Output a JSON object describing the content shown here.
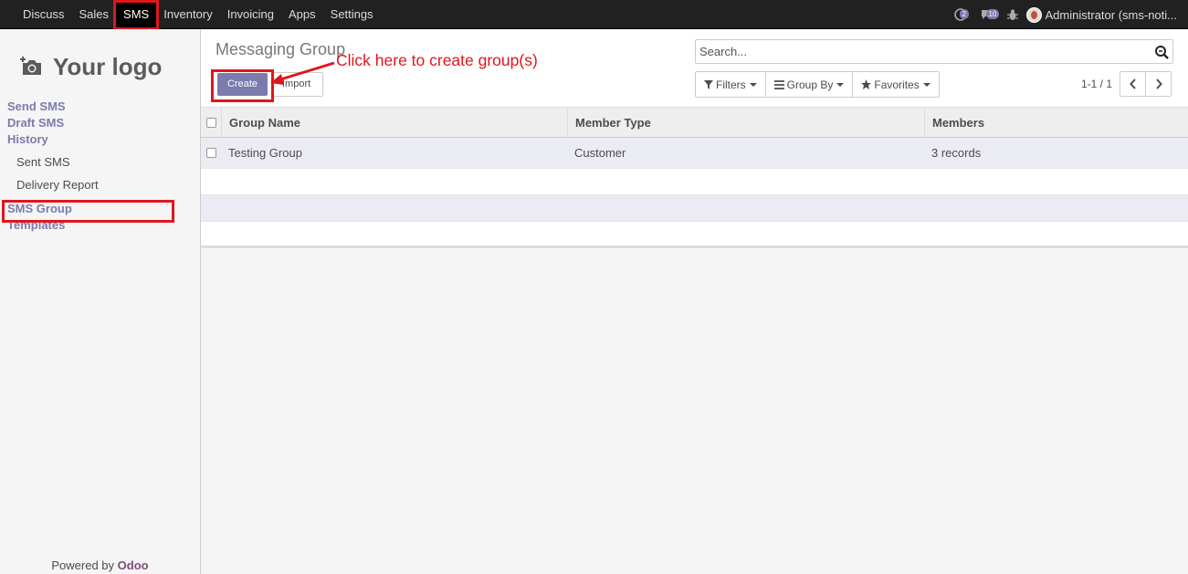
{
  "topbar": {
    "menu": [
      "Discuss",
      "Sales",
      "SMS",
      "Inventory",
      "Invoicing",
      "Apps",
      "Settings"
    ],
    "active": "SMS",
    "activity_count": "2",
    "message_count": "10",
    "user": "Administrator (sms-noti..."
  },
  "sidebar": {
    "logo_text": "Your logo",
    "links": {
      "send_sms": "Send SMS",
      "draft_sms": "Draft SMS",
      "history": "History",
      "sent_sms": "Sent SMS",
      "delivery_report": "Delivery Report",
      "sms_group": "SMS Group",
      "templates": "Templates"
    },
    "powered_prefix": "Powered by ",
    "powered_brand": "Odoo"
  },
  "control": {
    "title": "Messaging Group",
    "create": "Create",
    "import": "Import",
    "annotation": "Click here to create group(s)",
    "search_placeholder": "Search...",
    "filters": "Filters",
    "group_by": "Group By",
    "favorites": "Favorites",
    "pager": "1-1 / 1"
  },
  "table": {
    "columns": [
      "Group Name",
      "Member Type",
      "Members"
    ],
    "rows": [
      {
        "name": "Testing Group",
        "member_type": "Customer",
        "members": "3 records"
      }
    ]
  },
  "colors": {
    "accent": "#7c7bad",
    "annotation": "#e0161c",
    "navbar": "#212121"
  }
}
